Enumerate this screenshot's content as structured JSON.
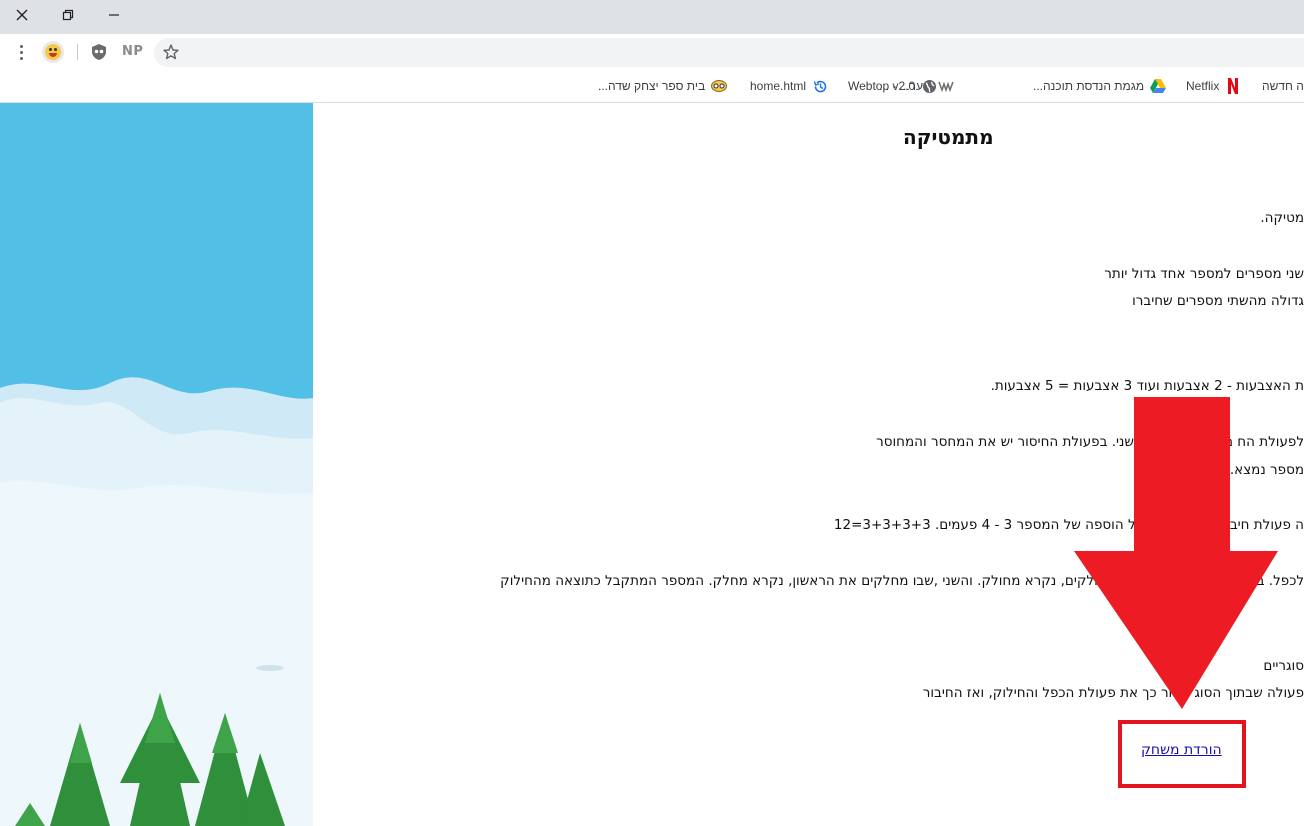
{
  "window": {
    "controls": [
      "close-icon",
      "restore-icon",
      "minimize-icon"
    ]
  },
  "toolbar": {
    "extensions": [
      "emoji-extension-icon",
      "shield-extension-icon",
      "NP"
    ],
    "star_icon": "star-icon"
  },
  "bookmarks": [
    {
      "label": "ה חדשה",
      "icon": "new-tab-icon"
    },
    {
      "label": "Netflix",
      "icon": "netflix-icon"
    },
    {
      "label": "מגמת הנדסת תוכנה...",
      "icon": "google-drive-icon"
    },
    {
      "label": "שער... - ...",
      "icon": "portal-icon"
    },
    {
      "label": "Webtop v2.0",
      "icon": "globe-icon"
    },
    {
      "label": "home.html",
      "icon": "history-icon"
    },
    {
      "label": "בית ספר יצחק שדה...",
      "icon": "school-icon"
    }
  ],
  "page": {
    "title": "מתמטיקה",
    "lines": [
      "מטיקה.",
      "שני מספרים למספר אחד גדול יותר",
      "גדולה מהשתי מספרים שחיברו",
      "ת האצבעות - 2 אצבעות ועוד 3 אצבעות = 5 אצבעות.",
      "לפעולת הח     ם מספר אחד מהשני. בפעולת החיסור יש את המחסר והמחוסר",
      "מספר נמצא.",
      "ה פעולת חיב     3 הוא הסכום של הוספה של המספר 3 - 4 פעמים. 3+3+3+3=12",
      "לכפל. ב       מספרים. הראשון שאותו מחלקים, נקרא מחולק. והשני ,שבו מחלקים את הראשון, נקרא מחלק. המספר המתקבל כתוצאה מהחילוק",
      "סוגריים",
      "פעולה שבתוך הסוג     ואחר כך את פעולת הכפל והחילוק, ואז החיבור"
    ],
    "download_link": "הורדת משחק"
  },
  "colors": {
    "accent_red": "#ed1c24",
    "link": "#1a0dab",
    "sky": "#57c1e8"
  }
}
